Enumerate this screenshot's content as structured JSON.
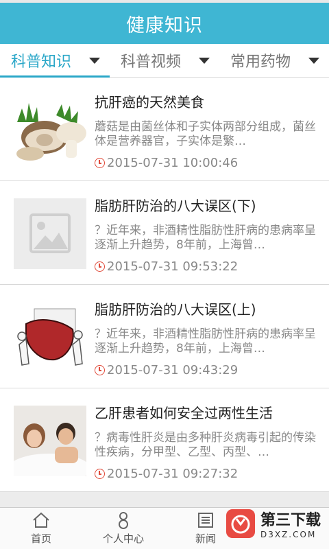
{
  "header": {
    "title": "健康知识"
  },
  "tabs": [
    {
      "label": "科普知识",
      "active": true
    },
    {
      "label": "科普视频",
      "active": false
    },
    {
      "label": "常用药物",
      "active": false
    }
  ],
  "articles": [
    {
      "title": "抗肝癌的天然美食",
      "summary": "蘑菇是由菌丝体和子实体两部分组成，菌丝体是营养器官，子实体是繁…",
      "time": "2015-07-31 10:00:46",
      "thumb": "mushroom-image"
    },
    {
      "title": "脂肪肝防治的八大误区(下)",
      "summary": "？近年来，非酒精性脂肪性肝病的患病率呈逐渐上升趋势，8年前，上海曾…",
      "time": "2015-07-31 09:53:22",
      "thumb": "placeholder-image"
    },
    {
      "title": "脂肪肝防治的八大误区(上)",
      "summary": "？近年来，非酒精性脂肪性肝病的患病率呈逐渐上升趋势，8年前，上海曾…",
      "time": "2015-07-31 09:43:29",
      "thumb": "liver-cartoon-image"
    },
    {
      "title": "乙肝患者如何安全过两性生活",
      "summary": "？病毒性肝炎是由多种肝炎病毒引起的传染性疾病，分甲型、乙型、丙型、…",
      "time": "2015-07-31 09:27:32",
      "thumb": "couple-photo-image"
    }
  ],
  "bottom_nav": [
    {
      "label": "首页",
      "icon": "home-icon"
    },
    {
      "label": "个人中心",
      "icon": "person-icon"
    },
    {
      "label": "新闻",
      "icon": "news-icon"
    }
  ],
  "watermark": {
    "title": "第三下载",
    "url": "D3XZ.COM"
  },
  "colors": {
    "header": "#3fb6d3",
    "active_tab": "#2aa7c8",
    "clock": "#e04a3a"
  }
}
